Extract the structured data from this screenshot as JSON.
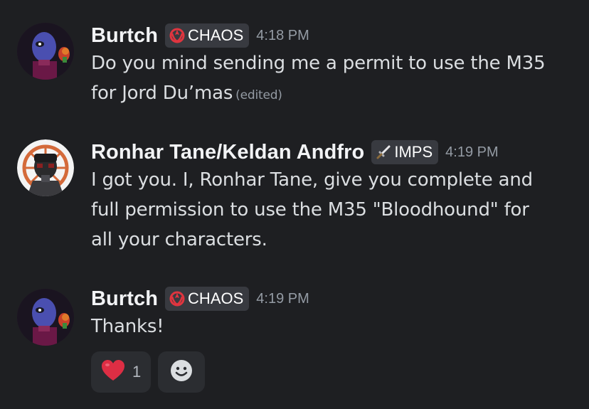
{
  "messages": [
    {
      "username": "Burtch",
      "tag": "CHAOS",
      "tag_icon": "rebel-alliance-icon",
      "timestamp": "4:18 PM",
      "lines": [
        "Do you mind sending me a permit to use the M35",
        "for Jord Du’mas"
      ],
      "edited": "(edited)"
    },
    {
      "username": "Ronhar Tane/Keldan Andfro",
      "tag": "IMPS",
      "tag_icon": "sword-icon",
      "timestamp": "4:19 PM",
      "lines": [
        "I got you. I, Ronhar Tane, give you complete and",
        "full permission to use the M35 \"Bloodhound\" for",
        "all your characters."
      ]
    },
    {
      "username": "Burtch",
      "tag": "CHAOS",
      "tag_icon": "rebel-alliance-icon",
      "timestamp": "4:19 PM",
      "lines": [
        "Thanks!"
      ],
      "reactions": [
        {
          "emoji": "❤️",
          "icon": "heart-icon",
          "count": "1"
        }
      ],
      "add_reaction_icon": "smiley-icon"
    }
  ],
  "colors": {
    "background": "#1e1f22",
    "tag_background": "#383a40",
    "reaction_background": "#2b2d31",
    "username": "#f2f3f5",
    "text": "#dbdee1",
    "muted": "#949ba4",
    "chaos_red": "#e0353f"
  }
}
